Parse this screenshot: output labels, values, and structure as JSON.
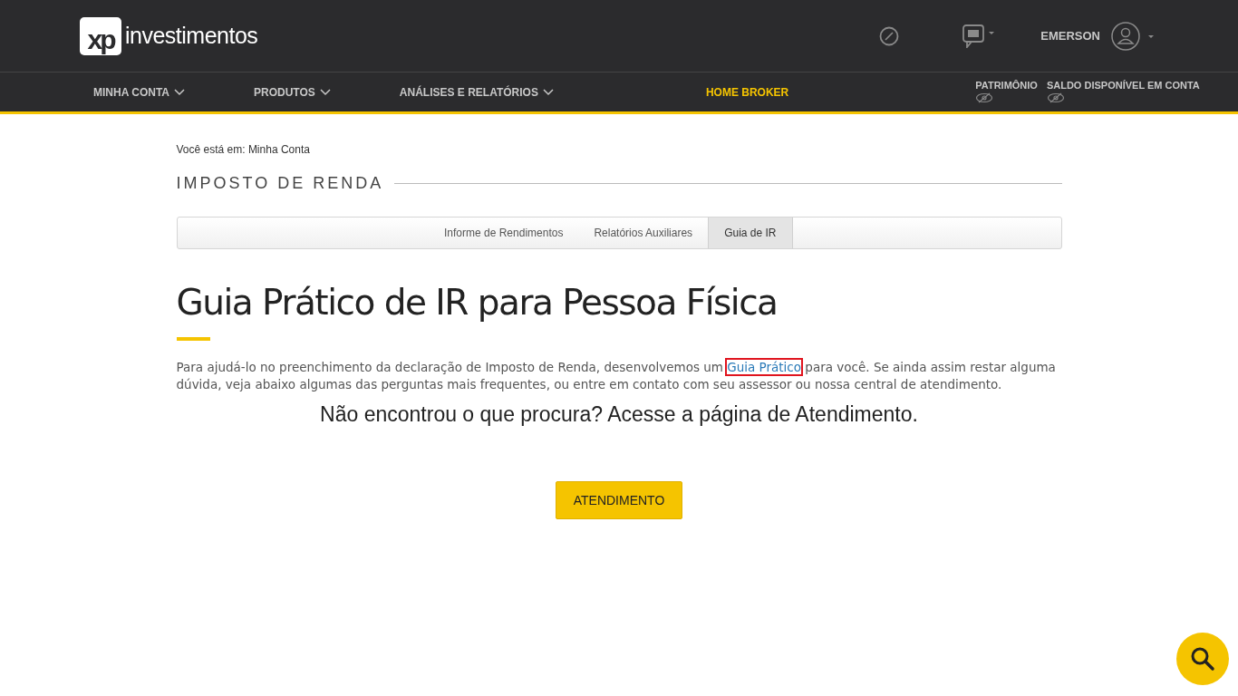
{
  "header": {
    "logo_mark": "xp",
    "logo_text": "investimentos",
    "user_name": "EMERSON"
  },
  "nav": {
    "items": [
      {
        "label": "MINHA CONTA",
        "kind": "dropdown"
      },
      {
        "label": "PRODUTOS",
        "kind": "dropdown"
      },
      {
        "label": "ANÁLISES E RELATÓRIOS",
        "kind": "dropdown"
      },
      {
        "label": "HOME BROKER",
        "kind": "highlight"
      }
    ],
    "balances": [
      {
        "label": "PATRIMÔNIO"
      },
      {
        "label": "SALDO DISPONÍVEL EM CONTA"
      }
    ]
  },
  "breadcrumb": "Você está em: Minha Conta",
  "section_title": "IMPOSTO DE RENDA",
  "tabs": [
    {
      "label": "Informe de Rendimentos",
      "selected": false
    },
    {
      "label": "Relatórios Auxiliares",
      "selected": false
    },
    {
      "label": "Guia de IR",
      "selected": true
    }
  ],
  "heading": "Guia Prático de IR para Pessoa Física",
  "intro": {
    "before": "Para ajudá-lo no preenchimento da declaração de Imposto de Renda, desenvolvemos um",
    "link": "Guia Prático",
    "after": "para você. Se ainda assim restar alguma dúvida, veja abaixo algumas das perguntas mais frequentes, ou entre em contato com seu assessor ou nossa central de atendimento."
  },
  "help_text": "Não encontrou o que procura? Acesse a página de Atendimento.",
  "button": "ATENDIMENTO"
}
